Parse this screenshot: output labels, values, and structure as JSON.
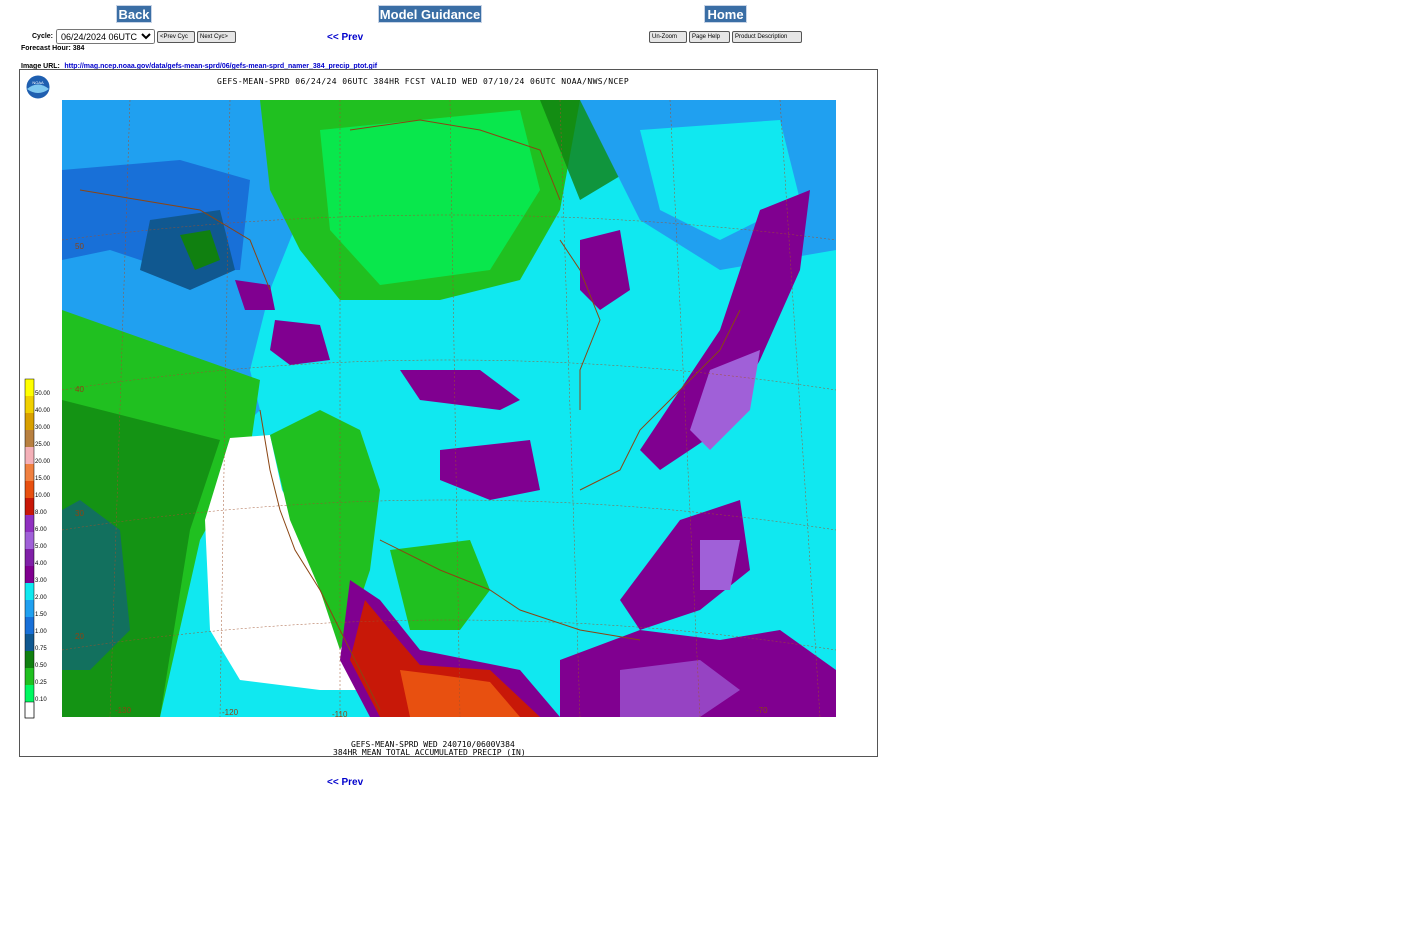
{
  "nav": {
    "back": "Back",
    "model_guidance": "Model Guidance",
    "home": "Home"
  },
  "controls": {
    "cycle_label": "Cycle:",
    "cycle_value": "06/24/2024 06UTC",
    "prev_cycle": "<Prev Cyc",
    "next_cycle": "Next Cyc>",
    "prev_link": "<< Prev",
    "unzoom": "Un-Zoom",
    "page_help": "Page Help",
    "product_description": "Product Description"
  },
  "info": {
    "forecast_hour": "Forecast Hour: 384",
    "image_url_label": "Image URL:",
    "image_url": "http://mag.ncep.noaa.gov/data/gefs-mean-sprd/06/gefs-mean-sprd_namer_384_precip_ptot.gif"
  },
  "map": {
    "header": "GEFS-MEAN-SPRD 06/24/24 06UTC 384HR FCST VALID WED 07/10/24 06UTC NOAA/NWS/NCEP",
    "footer_line1": "GEFS-MEAN-SPRD WED 240710/0600V384",
    "footer_line2": "384HR MEAN TOTAL ACCUMULATED PRECIP (IN)",
    "logo": "NOAA",
    "lat_labels": [
      "50",
      "40",
      "30",
      "20"
    ],
    "lon_labels": [
      "-130",
      "-120",
      "-110",
      "-70"
    ],
    "legend": [
      {
        "label": "50.00",
        "color": "#ffff00"
      },
      {
        "label": "40.00",
        "color": "#f0d000"
      },
      {
        "label": "30.00",
        "color": "#d8a000"
      },
      {
        "label": "25.00",
        "color": "#b88040"
      },
      {
        "label": "20.00",
        "color": "#f4b0b8"
      },
      {
        "label": "15.00",
        "color": "#f08040"
      },
      {
        "label": "10.00",
        "color": "#e85010"
      },
      {
        "label": "8.00",
        "color": "#c81808"
      },
      {
        "label": "6.00",
        "color": "#9030c0"
      },
      {
        "label": "5.00",
        "color": "#a060d8"
      },
      {
        "label": "4.00",
        "color": "#8020a8"
      },
      {
        "label": "3.00",
        "color": "#800090"
      },
      {
        "label": "2.00",
        "color": "#10e8f0"
      },
      {
        "label": "1.50",
        "color": "#20a0f0"
      },
      {
        "label": "1.00",
        "color": "#1870d8"
      },
      {
        "label": "0.75",
        "color": "#105890"
      },
      {
        "label": "0.50",
        "color": "#108010"
      },
      {
        "label": "0.25",
        "color": "#20c020"
      },
      {
        "label": "0.10",
        "color": "#00f860"
      }
    ]
  }
}
